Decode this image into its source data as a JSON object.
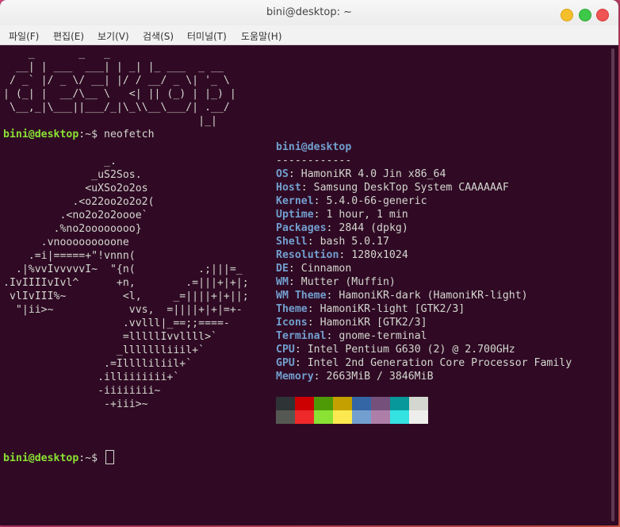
{
  "window": {
    "title": "bini@desktop: ~"
  },
  "menu": [
    "파일(F)",
    "편집(E)",
    "보기(V)",
    "검색(S)",
    "터미널(T)",
    "도움말(H)"
  ],
  "ascii_banner": "    _       _   _\n  __| | ___  ___| | _| |_ ___  _ __\n / _` |/ _ \\/ __| |/ / __/ _ \\| '_ \\\n| (_| |  __/\\__ \\   <| || (_) | |_) |\n \\__,_|\\___||___/_|\\_\\\\__\\___/| .__/\n                               |_|",
  "prompt": {
    "user_host": "bini@desktop",
    "path": ":~$ ",
    "command": "neofetch"
  },
  "logo_art": "                _.\n              _uS2Sos.\n             <uXSo2o2os\n           .<o22oo2o2o2(\n         .<no2o2o2oooe`\n        .%no2oooooooo}\n      .vnooooooooone\n    .=i|=====+\"!vnnn(\n  .|%vvIvvvvvI~  \"{n(          .;|||=_\n.IvIIIIvIvl^      +n,        .=|||+|+|;\n vlIvIII%~         <l,     _=||||+|+||;\n  \"|ii>~            vvs,  =||||+|+|=+-\n                   .vvlll|_==;;====-\n                   =lllllIvvllll>`\n                  _llllllliiil+`\n                .=Illlliliil+`\n               .illiiiiiii+`\n               -iiiiiiii~\n                -+iii>~",
  "info": {
    "header_user": "bini@desktop",
    "separator": "------------",
    "rows": [
      {
        "label": "OS",
        "value": "HamoniKR 4.0 Jin x86_64"
      },
      {
        "label": "Host",
        "value": "Samsung DeskTop System CAAAAAAF"
      },
      {
        "label": "Kernel",
        "value": "5.4.0-66-generic"
      },
      {
        "label": "Uptime",
        "value": "1 hour, 1 min"
      },
      {
        "label": "Packages",
        "value": "2844 (dpkg)"
      },
      {
        "label": "Shell",
        "value": "bash 5.0.17"
      },
      {
        "label": "Resolution",
        "value": "1280x1024"
      },
      {
        "label": "DE",
        "value": "Cinnamon"
      },
      {
        "label": "WM",
        "value": "Mutter (Muffin)"
      },
      {
        "label": "WM Theme",
        "value": "HamoniKR-dark (HamoniKR-light)"
      },
      {
        "label": "Theme",
        "value": "HamoniKR-light [GTK2/3]"
      },
      {
        "label": "Icons",
        "value": "HamoniKR [GTK2/3]"
      },
      {
        "label": "Terminal",
        "value": "gnome-terminal"
      },
      {
        "label": "CPU",
        "value": "Intel Pentium G630 (2) @ 2.700GHz"
      },
      {
        "label": "GPU",
        "value": "Intel 2nd Generation Core Processor Family"
      },
      {
        "label": "Memory",
        "value": "2663MiB / 3846MiB"
      }
    ]
  },
  "palette": {
    "normal": [
      "#2e3436",
      "#cc0000",
      "#4e9a06",
      "#c4a000",
      "#3465a4",
      "#75507b",
      "#06989a",
      "#d3d7cf"
    ],
    "bright": [
      "#555753",
      "#ef2929",
      "#8ae234",
      "#fce94f",
      "#729fcf",
      "#ad7fa8",
      "#34e2e2",
      "#eeeeec"
    ]
  },
  "prompt2": {
    "user_host": "bini@desktop",
    "path": ":~$ "
  }
}
